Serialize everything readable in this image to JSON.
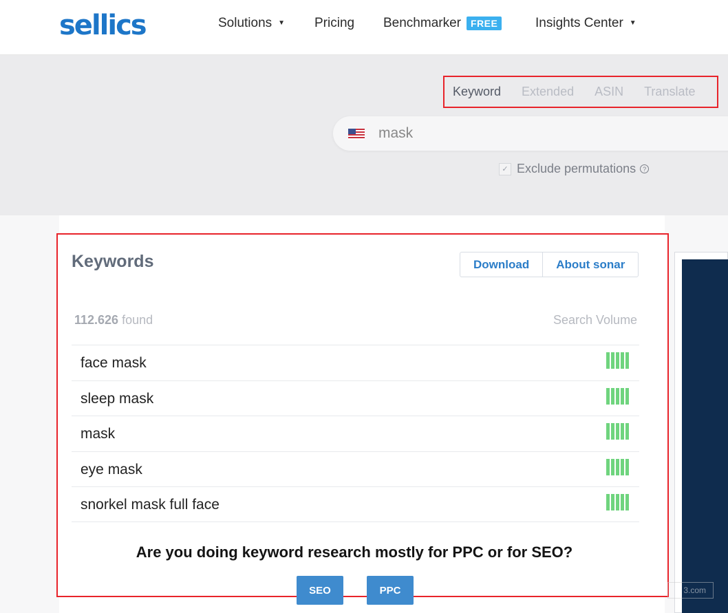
{
  "header": {
    "logo": "sellics",
    "nav": {
      "solutions": "Solutions",
      "pricing": "Pricing",
      "benchmarker": "Benchmarker",
      "free_badge": "FREE",
      "insights": "Insights Center"
    }
  },
  "search": {
    "tabs": [
      "Keyword",
      "Extended",
      "ASIN",
      "Translate"
    ],
    "active_tab": "Keyword",
    "query": "mask",
    "exclude_label": "Exclude permutations",
    "help_icon": "?"
  },
  "keywords": {
    "title": "Keywords",
    "download_label": "Download",
    "about_label": "About sonar",
    "found_count": "112.626",
    "found_suffix": "found",
    "search_volume_label": "Search Volume",
    "rows": [
      {
        "keyword": "face mask",
        "volume_bars": 5
      },
      {
        "keyword": "sleep mask",
        "volume_bars": 5
      },
      {
        "keyword": "mask",
        "volume_bars": 5
      },
      {
        "keyword": "eye mask",
        "volume_bars": 5
      },
      {
        "keyword": "snorkel mask full face",
        "volume_bars": 5
      }
    ],
    "question": "Are you doing keyword research mostly for PPC or for SEO?",
    "seo_label": "SEO",
    "ppc_label": "PPC"
  },
  "watermark": "3.com",
  "colors": {
    "brand": "#1d76c8",
    "accent_button": "#3f8bce",
    "volume_bar": "#6fd47e",
    "highlight_box": "#e8232a",
    "ad_panel": "#0f2c4e"
  }
}
